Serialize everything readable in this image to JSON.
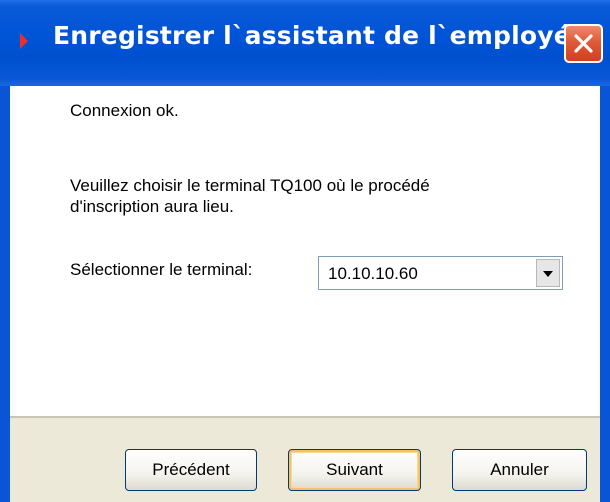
{
  "window": {
    "title": "Enregistrer l`assistant de l`employé",
    "title_icon": "red-arrow-icon",
    "close_icon": "close-icon"
  },
  "content": {
    "status_message": "Connexion ok.",
    "instruction_line1": "Veuillez choisir le terminal TQ100 où le procédé",
    "instruction_line2": "d'inscription aura lieu.",
    "terminal_label": "Sélectionner le terminal:",
    "terminal_select": {
      "selected_value": "10.10.10.60",
      "arrow_icon": "chevron-down-icon"
    }
  },
  "footer": {
    "previous_label": "Précédent",
    "next_label": "Suivant",
    "cancel_label": "Annuler"
  },
  "colors": {
    "titlebar": "#0054d6",
    "footer_bg": "#ece9d8",
    "close_button": "#e05a3a",
    "default_button_focus": "#f6c16a"
  }
}
